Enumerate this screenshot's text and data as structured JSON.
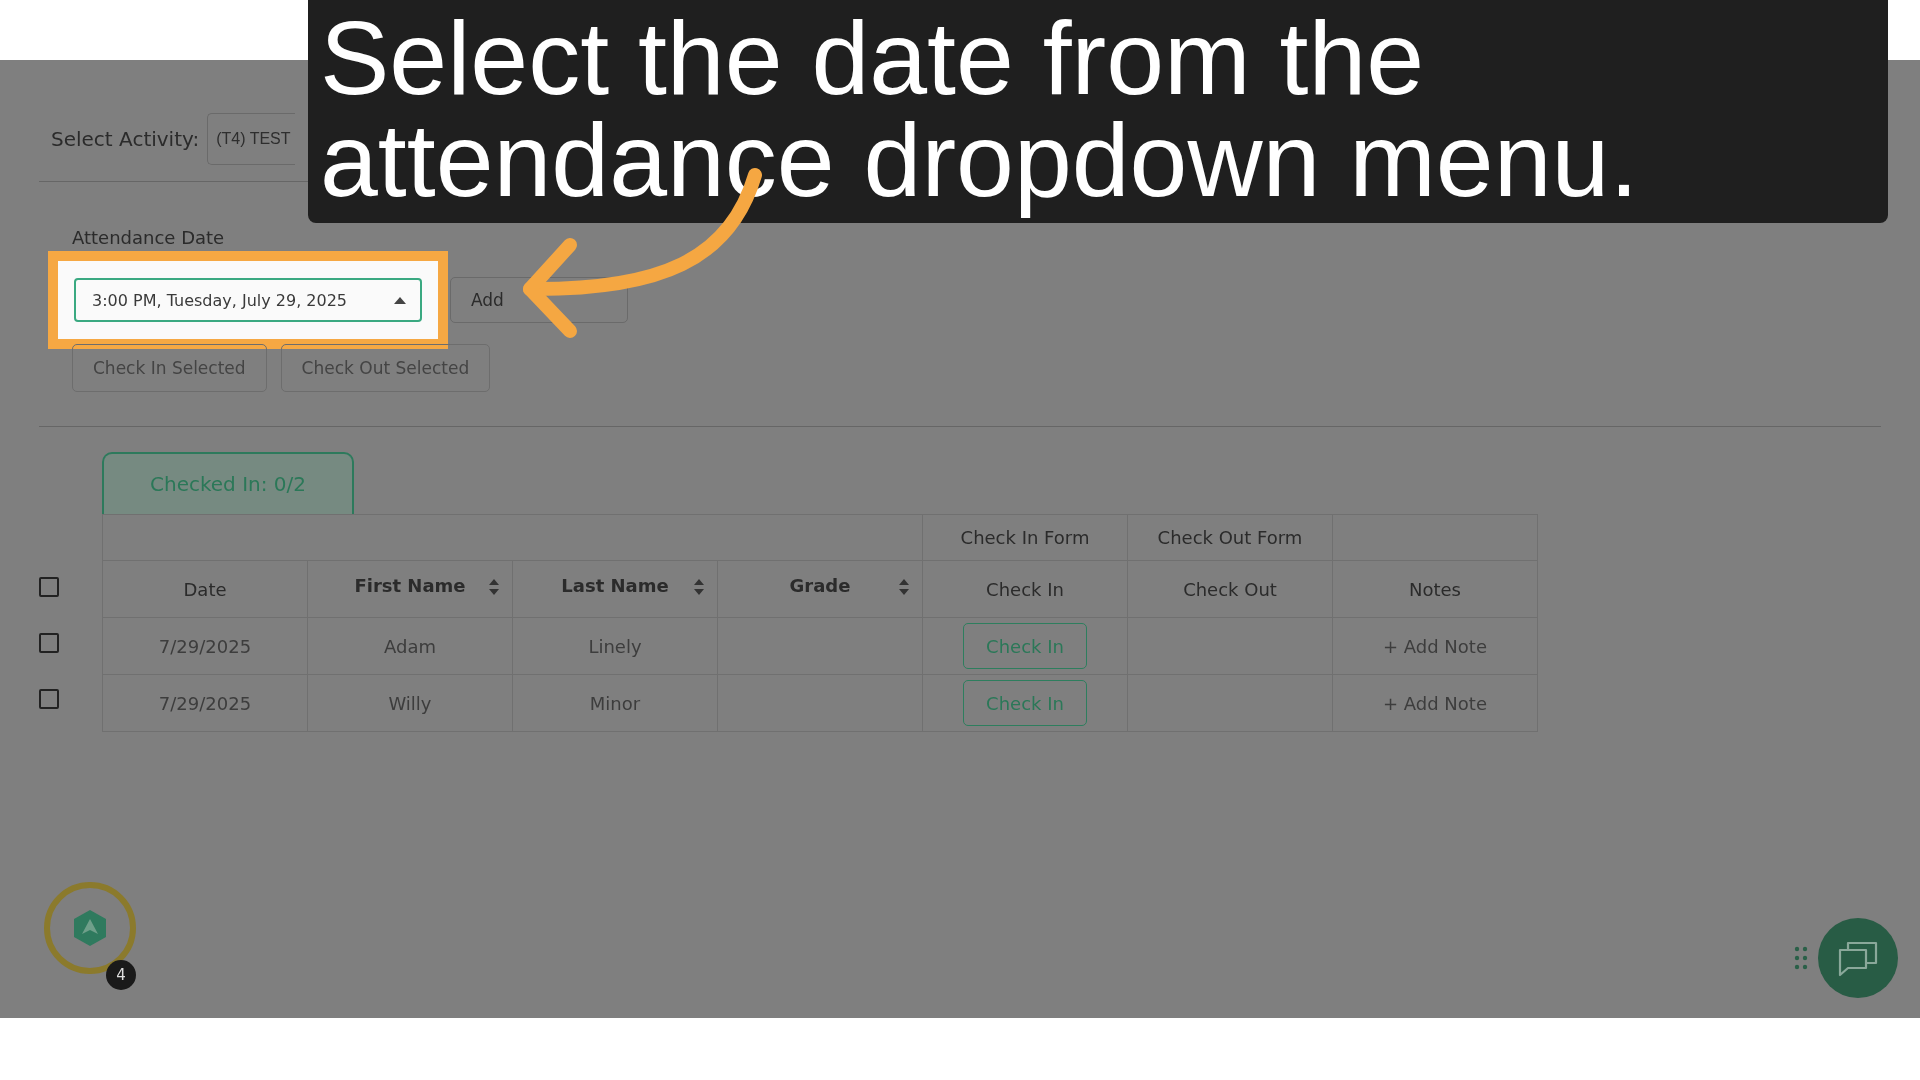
{
  "caption": {
    "text": "Select the date from the\nattendance dropdown menu."
  },
  "activity": {
    "label": "Select Activity:",
    "value": "(T4) TEST"
  },
  "attendance_date": {
    "label": "Attendance Date",
    "value": "3:00 PM, Tuesday, July 29, 2025",
    "expanded": true
  },
  "add_button": "Add",
  "bulk_buttons": [
    "Check In Selected",
    "Check Out Selected"
  ],
  "checked_in_tab": "Checked In: 0/2",
  "select_all": {
    "checked": false
  },
  "table": {
    "group_headers": [
      "Check In Form",
      "Check Out Form"
    ],
    "columns": [
      {
        "label": "Date",
        "sortable": false
      },
      {
        "label": "First Name",
        "sortable": true
      },
      {
        "label": "Last Name",
        "sortable": true
      },
      {
        "label": "Grade",
        "sortable": true
      },
      {
        "label": "Check In",
        "sortable": false
      },
      {
        "label": "Check Out",
        "sortable": false
      },
      {
        "label": "Notes",
        "sortable": false
      }
    ],
    "rows": [
      {
        "checked": false,
        "date": "7/29/2025",
        "first_name": "Adam",
        "last_name": "Linely",
        "action": "Check In",
        "note": "+ Add Note"
      },
      {
        "checked": false,
        "date": "7/29/2025",
        "first_name": "Willy",
        "last_name": "Minor",
        "action": "Check In",
        "note": "+ Add Note"
      }
    ]
  },
  "helper_badge": "4"
}
